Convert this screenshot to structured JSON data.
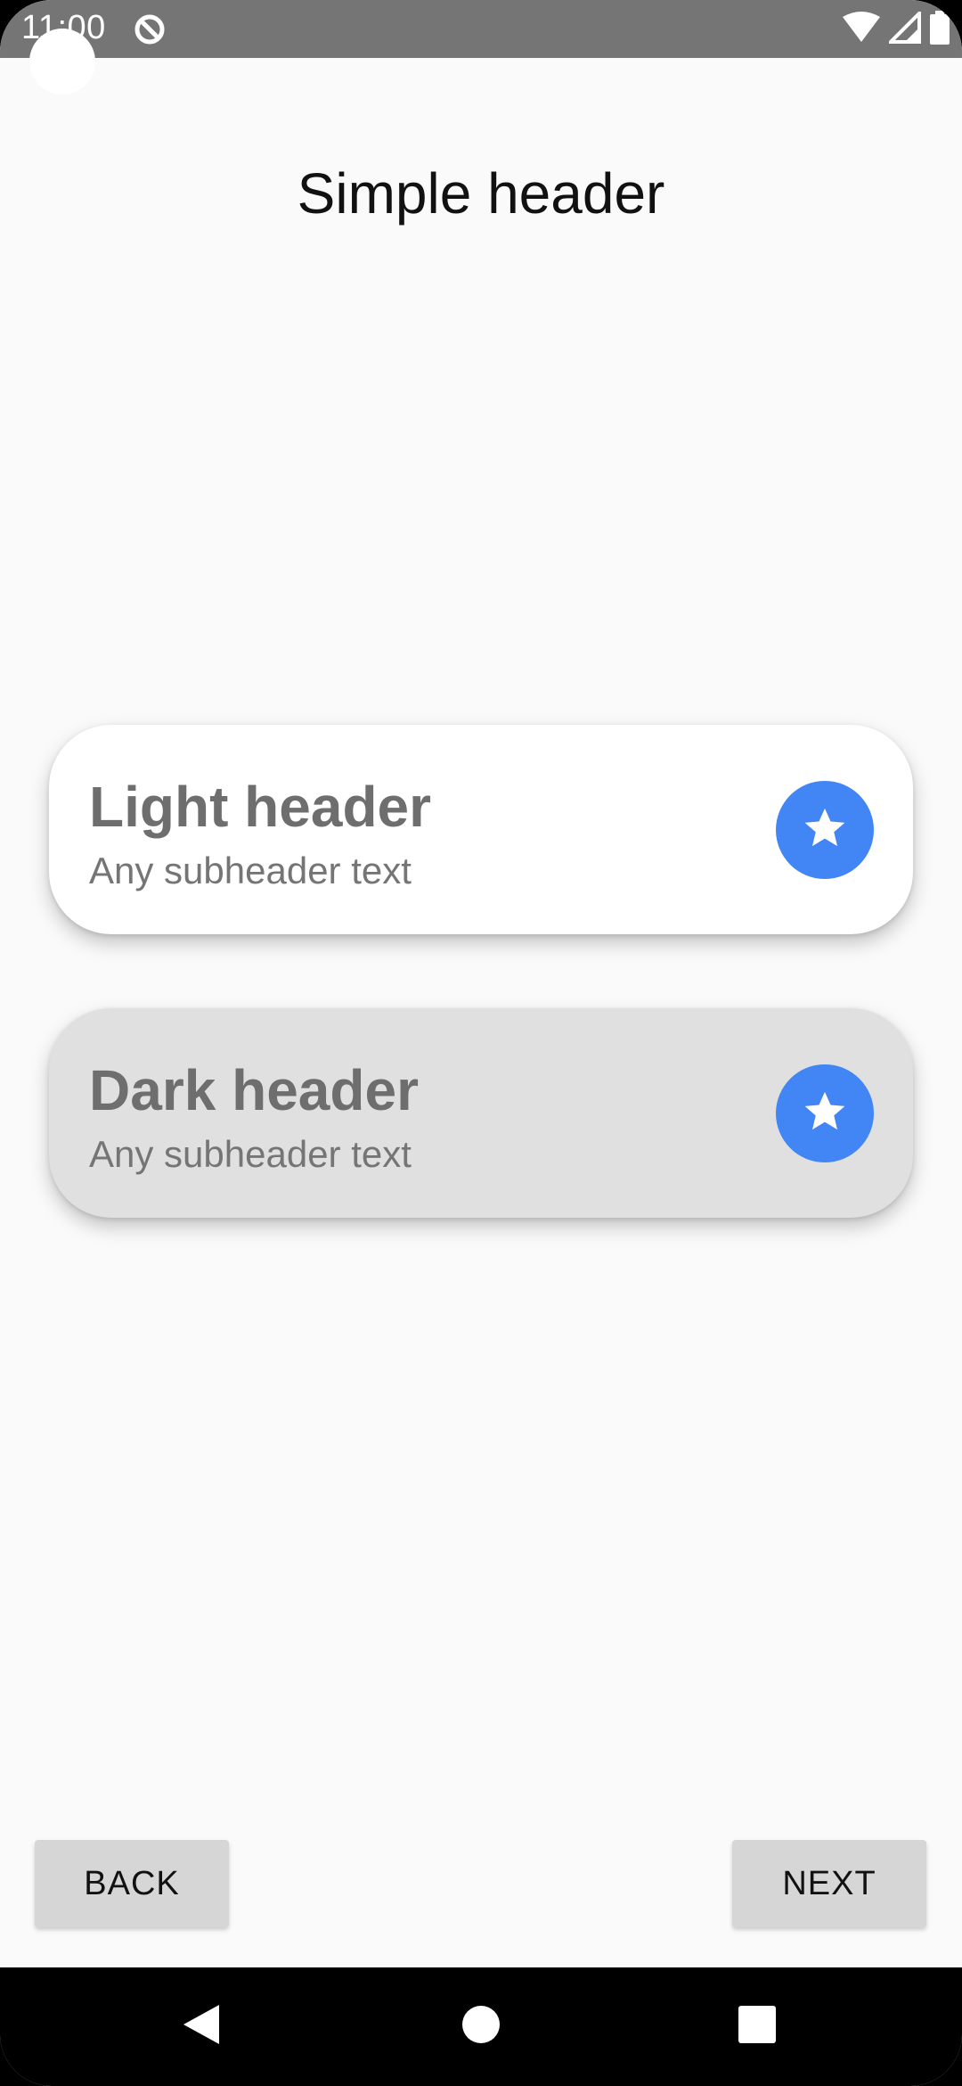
{
  "status_bar": {
    "time": "11:00",
    "icons": [
      "sync-icon",
      "wifi-icon",
      "signal-icon",
      "battery-icon"
    ]
  },
  "page": {
    "title": "Simple header"
  },
  "cards": [
    {
      "title": "Light header",
      "subtitle": "Any subheader text",
      "icon": "star-icon",
      "background": "#ffffff"
    },
    {
      "title": "Dark header",
      "subtitle": "Any subheader text",
      "icon": "star-icon",
      "background": "#e0e0e0"
    }
  ],
  "buttons": {
    "back_label": "BACK",
    "next_label": "NEXT"
  },
  "system_nav": {
    "icons": [
      "back-triangle-icon",
      "home-circle-icon",
      "recents-square-icon"
    ]
  },
  "colors": {
    "accent": "#4285f4",
    "status_bar": "#757575",
    "background": "#fafafa"
  }
}
